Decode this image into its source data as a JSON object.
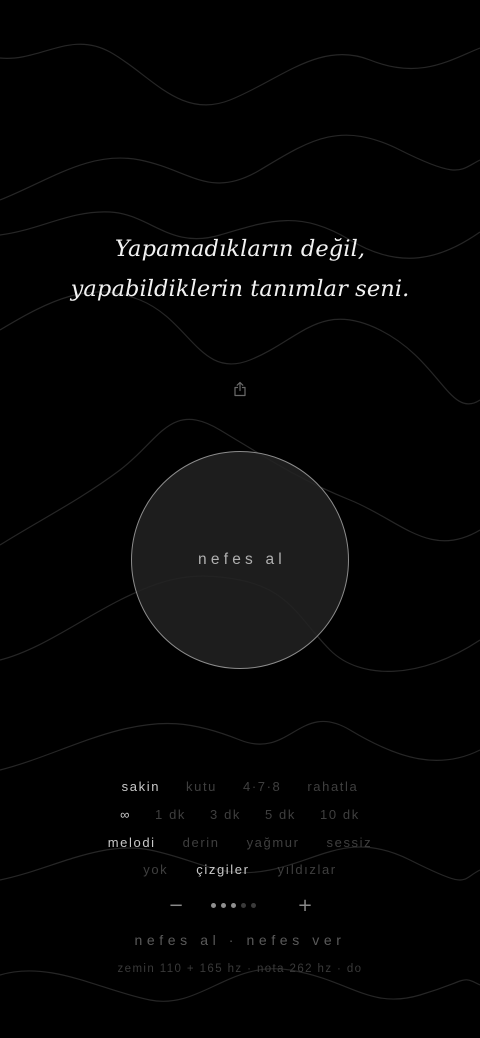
{
  "quote": {
    "line1": "Yapamadıkların değil,",
    "line2": "yapabildiklerin tanımlar seni."
  },
  "share": {
    "icon": "share-icon"
  },
  "breath": {
    "label": "nefes al"
  },
  "modes": [
    {
      "label": "sakin",
      "active": true
    },
    {
      "label": "kutu",
      "active": false
    },
    {
      "label": "4·7·8",
      "active": false
    },
    {
      "label": "rahatla",
      "active": false
    }
  ],
  "durations": [
    {
      "label": "∞",
      "active": true
    },
    {
      "label": "1 dk",
      "active": false
    },
    {
      "label": "3 dk",
      "active": false
    },
    {
      "label": "5 dk",
      "active": false
    },
    {
      "label": "10 dk",
      "active": false
    }
  ],
  "sounds": [
    {
      "label": "melodi",
      "active": true
    },
    {
      "label": "derin",
      "active": false
    },
    {
      "label": "yağmur",
      "active": false
    },
    {
      "label": "sessiz",
      "active": false
    }
  ],
  "visuals": [
    {
      "label": "yok",
      "active": false
    },
    {
      "label": "çizgiler",
      "active": true
    },
    {
      "label": "yıldızlar",
      "active": false
    }
  ],
  "stepper": {
    "minus": "−",
    "plus": "+",
    "level": 3,
    "steps": 5
  },
  "captions": {
    "breath": "nefes al · nefes ver",
    "freq": "zemin 110 + 165 hz · nota 262 hz · do"
  },
  "colors": {
    "background": "#000000",
    "text_active": "#c9c9c9",
    "text_inactive": "#3f3f3f",
    "wave": "#2a2a2a",
    "circle_fill": "#222222",
    "circle_border": "#8c8c8c"
  }
}
